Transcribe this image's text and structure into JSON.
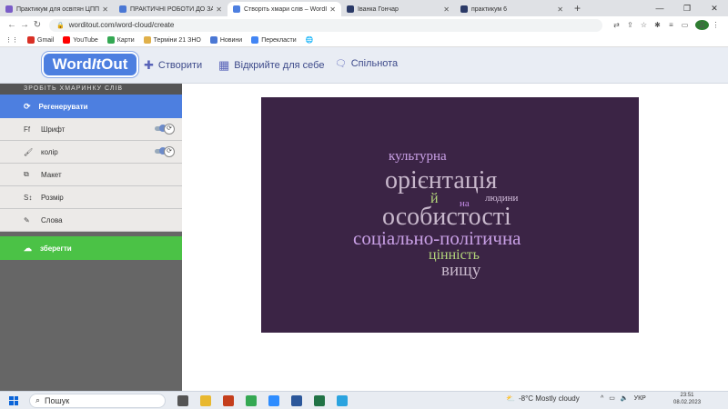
{
  "browser": {
    "tabs": [
      {
        "title": "Практикум для освітян ЦПП (VI)",
        "icon": "doc-icon",
        "color": "#7a5cc7",
        "active": false
      },
      {
        "title": "ПРАКТИЧНІ РОБОТИ ДО ЗАНЯТ",
        "icon": "doc-icon",
        "color": "#4a77d4",
        "active": false
      },
      {
        "title": "Створіть хмари слів – WordItOut",
        "icon": "cloud-icon",
        "color": "#4d7fe0",
        "active": true
      },
      {
        "title": "Іванка Гончар",
        "icon": "mh-icon",
        "color": "#2b3a67",
        "active": false
      },
      {
        "title": "практикум 6",
        "icon": "mh-icon",
        "color": "#2b3a67",
        "active": false
      }
    ],
    "new_tab": "+",
    "url": "worditout.com/word-cloud/create",
    "profile_initial": "Д",
    "bookmarks": [
      {
        "label": "Gmail",
        "color": "#d93025"
      },
      {
        "label": "YouTube",
        "color": "#ff0000"
      },
      {
        "label": "Карти",
        "color": "#34a853"
      },
      {
        "label": "Терміни 21 ЗНО",
        "color": "#e0b04a"
      },
      {
        "label": "Новини",
        "color": "#4a77d4"
      },
      {
        "label": "Перекласти",
        "color": "#4285f4"
      }
    ]
  },
  "site": {
    "logo_word": "Word",
    "logo_it": "It",
    "logo_out": "Out",
    "nav": [
      {
        "label": "Створити",
        "icon": "plus-icon",
        "glyph": "✚"
      },
      {
        "label": "Відкрийте для себе",
        "icon": "grid-icon",
        "glyph": "▦"
      },
      {
        "label": "Спільнота",
        "icon": "chat-icon",
        "glyph": "💬"
      }
    ]
  },
  "sidebar": {
    "title": "ЗРОБІТЬ ХМАРИНКУ СЛІВ",
    "regenerate": "Регенерувати",
    "items": [
      {
        "label": "Шрифт",
        "icon": "font-icon",
        "glyph": "Ff",
        "toggle": true
      },
      {
        "label": "колір",
        "icon": "palette-icon",
        "glyph": "🖌",
        "toggle": true
      },
      {
        "label": "Макет",
        "icon": "layout-icon",
        "glyph": "⧉",
        "toggle": false
      },
      {
        "label": "Розмір",
        "icon": "size-icon",
        "glyph": "S↕",
        "toggle": false
      },
      {
        "label": "Слова",
        "icon": "edit-icon",
        "glyph": "✎",
        "toggle": false
      }
    ],
    "save": "зберегти"
  },
  "cloud": {
    "background": "#3b2445",
    "words": [
      {
        "text": "культурна",
        "color": "#c9a0e6"
      },
      {
        "text": "орієнтація",
        "color": "#c8b8cc"
      },
      {
        "text": "й",
        "color": "#b3d67a"
      },
      {
        "text": "на",
        "color": "#c58be8"
      },
      {
        "text": "людини",
        "color": "#d7c2e0"
      },
      {
        "text": "особистості",
        "color": "#c8b8cc"
      },
      {
        "text": "соціально-політична",
        "color": "#c9a0e6"
      },
      {
        "text": "цінність",
        "color": "#b3d67a"
      },
      {
        "text": "вищу",
        "color": "#c8b8cc"
      }
    ]
  },
  "taskbar": {
    "search": "Пошук",
    "apps": [
      {
        "name": "task-view-icon",
        "color": "#555"
      },
      {
        "name": "explorer-icon",
        "color": "#e8b830"
      },
      {
        "name": "powerpoint-icon",
        "color": "#c43e1c"
      },
      {
        "name": "chrome-icon",
        "color": "#34a853"
      },
      {
        "name": "zoom-icon",
        "color": "#2d8cff"
      },
      {
        "name": "word-icon",
        "color": "#2b579a"
      },
      {
        "name": "excel-icon",
        "color": "#217346"
      },
      {
        "name": "telegram-icon",
        "color": "#2aa3df"
      }
    ],
    "weather": "-8°C  Mostly cloudy",
    "lang": "УКР",
    "time": "23:51",
    "date": "08.02.2023"
  }
}
